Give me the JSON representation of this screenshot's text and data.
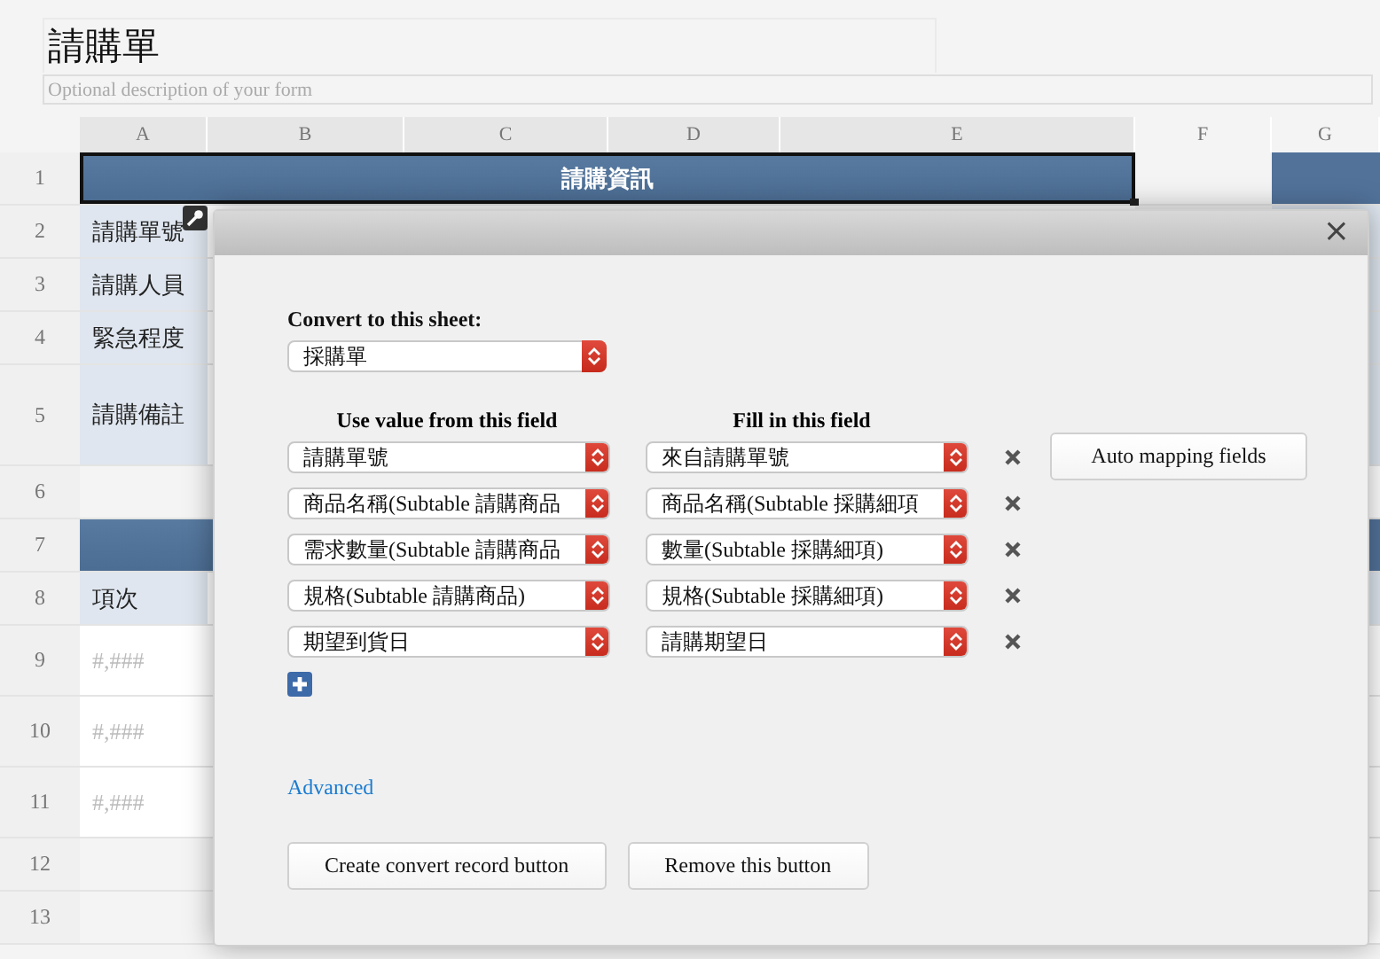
{
  "form": {
    "title": "請購單",
    "description_placeholder": "Optional description of your form"
  },
  "sheet": {
    "columns": [
      "A",
      "B",
      "C",
      "D",
      "E",
      "F",
      "G"
    ],
    "rows": [
      {
        "number": "1",
        "kind": "section",
        "text": "請購資訊",
        "selected": true
      },
      {
        "number": "2",
        "kind": "label",
        "text": "請購單號",
        "selected": false
      },
      {
        "number": "3",
        "kind": "label",
        "text": "請購人員",
        "selected": false
      },
      {
        "number": "4",
        "kind": "label",
        "text": "緊急程度",
        "selected": false
      },
      {
        "number": "5",
        "kind": "label",
        "text": "請購備註",
        "selected": false
      },
      {
        "number": "6",
        "kind": "blank",
        "selected": false
      },
      {
        "number": "7",
        "kind": "section",
        "selected": false
      },
      {
        "number": "8",
        "kind": "label",
        "text": "項次",
        "selected": false
      },
      {
        "number": "9",
        "kind": "format",
        "text": "#,###",
        "selected": false
      },
      {
        "number": "10",
        "kind": "format",
        "text": "#,###",
        "selected": false
      },
      {
        "number": "11",
        "kind": "format",
        "text": "#,###",
        "selected": false
      },
      {
        "number": "12",
        "kind": "blank",
        "selected": false
      },
      {
        "number": "13",
        "kind": "blank",
        "selected": false
      }
    ]
  },
  "dialog": {
    "close": "×",
    "sheet_label": "Convert to this sheet:",
    "sheet_value": "採購單",
    "source_heading": "Use value from this field",
    "target_heading": "Fill in this field",
    "mappings": [
      {
        "source": "請購單號",
        "target": "來自請購單號"
      },
      {
        "source": "商品名稱(Subtable 請購商品",
        "target": "商品名稱(Subtable 採購細項"
      },
      {
        "source": "需求數量(Subtable 請購商品",
        "target": "數量(Subtable 採購細項)"
      },
      {
        "source": "規格(Subtable 請購商品)",
        "target": "規格(Subtable 採購細項)"
      },
      {
        "source": "期望到貨日",
        "target": "請購期望日"
      }
    ],
    "auto_button": "Auto mapping fields",
    "advanced": "Advanced",
    "buttons": [
      "Create convert record button",
      "Remove this button"
    ]
  }
}
